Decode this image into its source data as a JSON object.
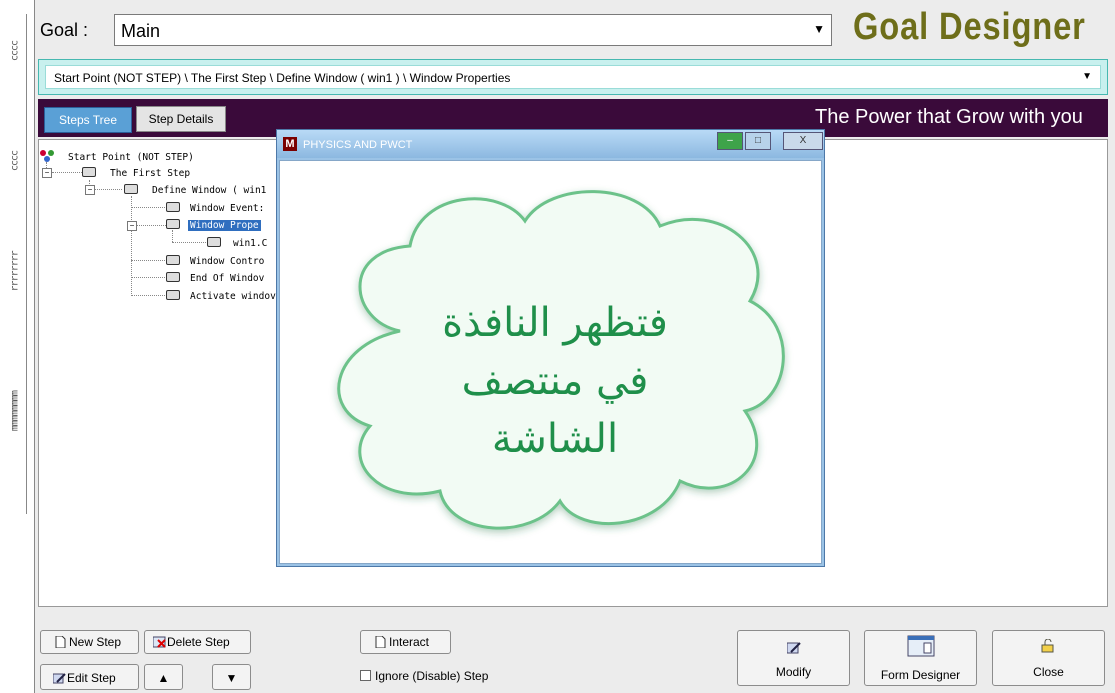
{
  "goal": {
    "label": "Goal :",
    "value": "Main"
  },
  "brand": {
    "title": "Goal Designer",
    "slogan": "The Power that Grow with you",
    "title_color": "#6e6e1a",
    "band_color": "#3a0a3a"
  },
  "path": {
    "text": "Start Point (NOT STEP)  \\  The First Step  \\  Define Window  ( win1 )  \\  Window Properties"
  },
  "tabs": {
    "steps_tree": "Steps Tree",
    "step_details": "Step Details"
  },
  "tree": {
    "items": [
      {
        "label": "Start Point (NOT STEP)"
      },
      {
        "label": "The First Step"
      },
      {
        "label": "Define Window  ( win1"
      },
      {
        "label": "Window Event:"
      },
      {
        "label": "Window Prope"
      },
      {
        "label": "win1.C"
      },
      {
        "label": "Window Contro"
      },
      {
        "label": "End Of Windov"
      },
      {
        "label": "Activate windov"
      }
    ]
  },
  "popup": {
    "title": "PHYSICS AND PWCT",
    "icon_letter": "M",
    "min_glyph": "–",
    "max_glyph": "□",
    "close_glyph": "X",
    "cloud_lines": [
      "فتظهر النافذة",
      "في منتصف",
      "الشاشة"
    ]
  },
  "toolbar": {
    "new_step": "New Step",
    "delete_step": "Delete Step",
    "interact": "Interact",
    "edit_step": "Edit Step",
    "ignore_step": "Ignore (Disable) Step",
    "modify": "Modify",
    "form_designer": "Form Designer",
    "close": "Close"
  },
  "icons": {
    "goal_dropdown": "chevron-down-icon",
    "path_dropdown": "chevron-down-icon",
    "move_up": "triangle-up-icon",
    "move_down": "triangle-down-icon"
  }
}
